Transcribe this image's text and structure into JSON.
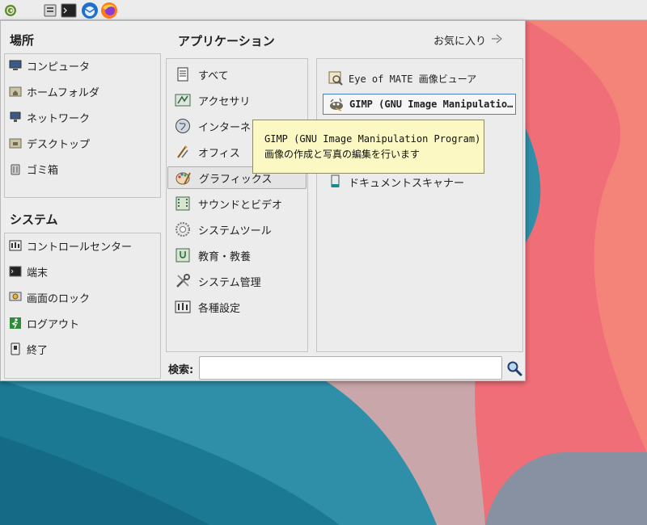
{
  "panel": {
    "icons": [
      "mate-menu-icon",
      "file-manager-icon",
      "terminal-icon",
      "thunderbird-icon",
      "firefox-icon"
    ]
  },
  "places": {
    "title": "場所",
    "items": [
      {
        "label": "コンピュータ",
        "icon": "computer-icon"
      },
      {
        "label": "ホームフォルダ",
        "icon": "home-folder-icon"
      },
      {
        "label": "ネットワーク",
        "icon": "network-icon"
      },
      {
        "label": "デスクトップ",
        "icon": "desktop-folder-icon"
      },
      {
        "label": "ゴミ箱",
        "icon": "trash-icon"
      }
    ]
  },
  "system": {
    "title": "システム",
    "items": [
      {
        "label": "コントロールセンター",
        "icon": "control-center-icon"
      },
      {
        "label": "端末",
        "icon": "terminal-icon"
      },
      {
        "label": "画面のロック",
        "icon": "lock-screen-icon"
      },
      {
        "label": "ログアウト",
        "icon": "logout-icon"
      },
      {
        "label": "終了",
        "icon": "shutdown-icon"
      }
    ]
  },
  "applications": {
    "title": "アプリケーション",
    "favorites_label": "お気に入り",
    "categories": [
      {
        "label": "すべて",
        "icon": "all-apps-icon"
      },
      {
        "label": "アクセサリ",
        "icon": "accessories-icon"
      },
      {
        "label": "インターネット",
        "icon": "internet-icon"
      },
      {
        "label": "オフィス",
        "icon": "office-icon"
      },
      {
        "label": "グラフィックス",
        "icon": "graphics-icon",
        "selected": true
      },
      {
        "label": "サウンドとビデオ",
        "icon": "sound-video-icon"
      },
      {
        "label": "システムツール",
        "icon": "system-tools-icon"
      },
      {
        "label": "教育・教養",
        "icon": "education-icon"
      },
      {
        "label": "システム管理",
        "icon": "administration-icon"
      },
      {
        "label": "各種設定",
        "icon": "preferences-icon"
      }
    ],
    "apps": [
      {
        "label": "Eye of MATE 画像ビューア",
        "icon": "image-viewer-icon"
      },
      {
        "label": "GIMP (GNU Image Manipulatio…",
        "icon": "gimp-icon",
        "focused": true
      },
      {
        "label": "ドキュメントスキャナー",
        "icon": "scanner-icon"
      }
    ]
  },
  "search": {
    "label": "検索:",
    "value": "",
    "placeholder": ""
  },
  "tooltip": {
    "line1": "GIMP (GNU Image Manipulation Program)",
    "line2": "画像の作成と写真の編集を行います"
  },
  "colors": {
    "accent": "#4a7fc1",
    "tooltip_bg": "#fbf8c4"
  }
}
